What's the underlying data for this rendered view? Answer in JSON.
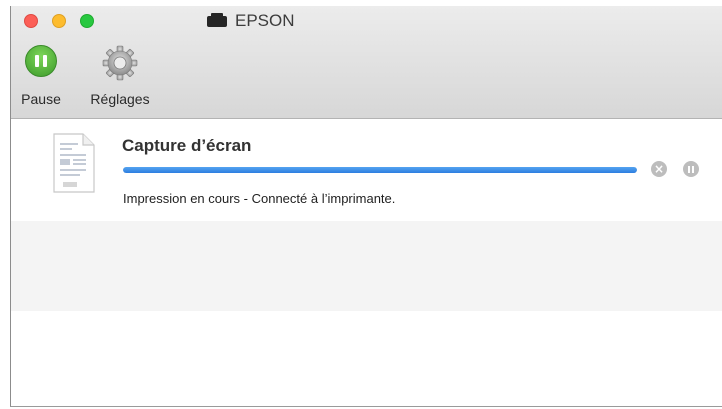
{
  "window": {
    "title": "EPSON",
    "printer_icon": "printer-icon"
  },
  "toolbar": {
    "pause_label": "Pause",
    "settings_label": "Réglages",
    "pause_icon": "pause-icon",
    "settings_icon": "gear-icon"
  },
  "job": {
    "name": "Capture d’écran",
    "status": "Impression en cours - Connecté à l’imprimante.",
    "progress": 1.0,
    "icon": "document-icon",
    "cancel_icon": "cancel-icon",
    "hold_icon": "pause-icon"
  },
  "colors": {
    "progress": "#3b8ee8",
    "pause_green": "#4caf34",
    "close": "#fc5f57",
    "minimize": "#fdbc2e",
    "maximize": "#28c840"
  }
}
